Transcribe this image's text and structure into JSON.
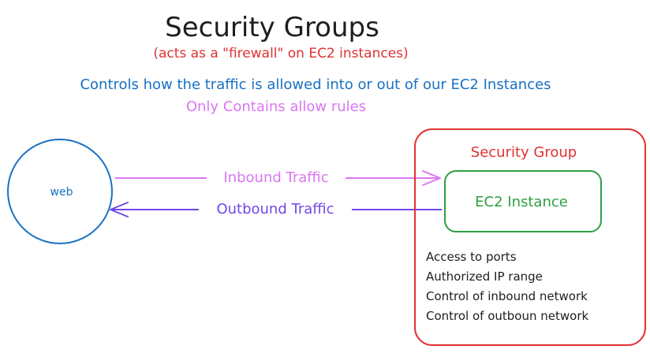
{
  "title": "Security Groups",
  "subtitle": "(acts as a \"firewall\" on EC2 instances)",
  "description": "Controls how the traffic is allowed into or out of our EC2 Instances",
  "note": "Only Contains allow rules",
  "web_node": {
    "label": "web"
  },
  "inbound_arrow": {
    "label": "Inbound Traffic"
  },
  "outbound_arrow": {
    "label": "Outbound Traffic"
  },
  "security_group": {
    "label": "Security Group",
    "instance_label": "EC2 Instance",
    "features": [
      "Access to ports",
      "Authorized IP range",
      "Control of inbound network",
      "Control of outboun network"
    ]
  },
  "colors": {
    "title": "#1e1e1e",
    "subtitle": "#e03131",
    "description": "#1971c2",
    "note": "#da77f2",
    "web": "#1971c2",
    "inbound": "#da77f2",
    "outbound": "#7048e8",
    "security_group": "#e03131",
    "instance": "#2f9e44",
    "features": "#1e1e1e"
  }
}
